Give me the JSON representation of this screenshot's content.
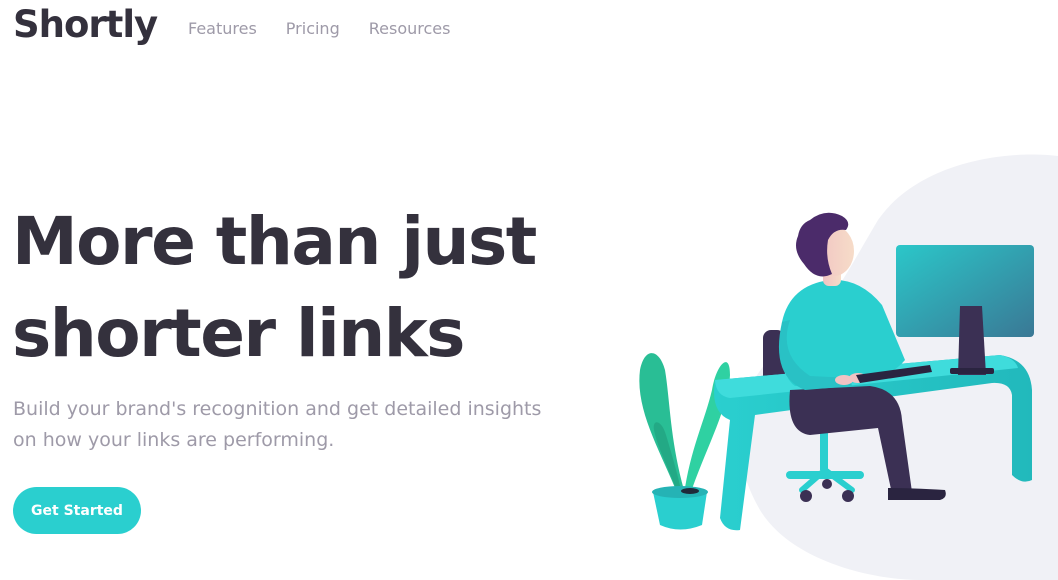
{
  "brand": {
    "name": "Shortly"
  },
  "nav": {
    "items": [
      "Features",
      "Pricing",
      "Resources"
    ]
  },
  "hero": {
    "title_line1": "More than just",
    "title_line2": "shorter links",
    "subtitle_line1": "Build your brand's recognition and get detailed insights",
    "subtitle_line2": "on how your links are performing.",
    "cta_label": "Get Started"
  },
  "colors": {
    "primary": "#2acfcf",
    "dark": "#34313d",
    "gray": "#9e9aa8",
    "violet": "#3b3054",
    "blob": "#f0f1f6"
  },
  "illustration": {
    "name": "person-working-at-desk-illustration"
  }
}
